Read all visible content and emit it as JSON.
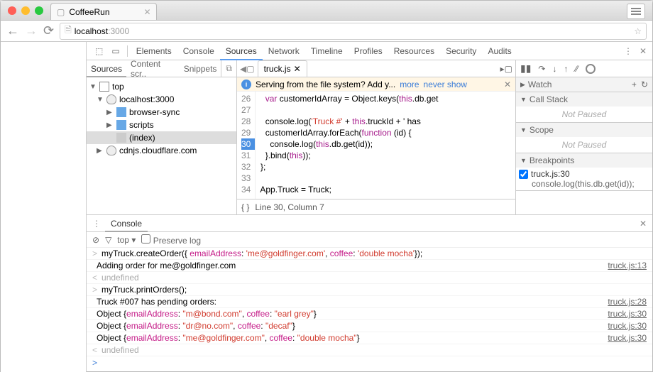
{
  "browser": {
    "title": "CoffeeRun",
    "url_host": "localhost",
    "url_path": ":3000"
  },
  "devtabs": [
    "Elements",
    "Console",
    "Sources",
    "Network",
    "Timeline",
    "Profiles",
    "Resources",
    "Security",
    "Audits"
  ],
  "devtabs_active": "Sources",
  "p1": {
    "tabs": [
      "Sources",
      "Content scr..",
      "Snippets"
    ],
    "tree": {
      "top": "top",
      "host": "localhost:3000",
      "browser_sync": "browser-sync",
      "scripts": "scripts",
      "index": "(index)",
      "cdn": "cdnjs.cloudflare.com"
    }
  },
  "file": {
    "name": "truck.js"
  },
  "info": {
    "msg": "Serving from the file system? Add y...",
    "more": "more",
    "never": "never show"
  },
  "code": {
    "start": 26,
    "highlight": 30,
    "lines": [
      "    var customerIdArray = Object.keys(this.db.get",
      "",
      "    console.log('Truck #' + this.truckId + ' has",
      "    customerIdArray.forEach(function (id) {",
      "      console.log(this.db.get(id));",
      "    }.bind(this));",
      "  };",
      "",
      "  App.Truck = Truck;"
    ]
  },
  "status": {
    "pos": "Line 30, Column 7"
  },
  "sections": {
    "watch": "Watch",
    "callstack": "Call Stack",
    "np": "Not Paused",
    "scope": "Scope",
    "breakpoints": "Breakpoints"
  },
  "bp": {
    "label": "truck.js:30",
    "code": "console.log(this.db.get(id));"
  },
  "drawer": {
    "tab": "Console"
  },
  "conbar": {
    "ctx": "top",
    "preserve": "Preserve log"
  },
  "console": [
    {
      "pfx": ">",
      "text": "myTruck.createOrder({ emailAddress: 'me@goldfinger.com', coffee: 'double mocha'});",
      "link": ""
    },
    {
      "pfx": "",
      "text": "Adding order for me@goldfinger.com",
      "link": "truck.js:13"
    },
    {
      "pfx": "<",
      "text": "undefined",
      "link": "",
      "und": true
    },
    {
      "pfx": ">",
      "text": "myTruck.printOrders();",
      "link": ""
    },
    {
      "pfx": "",
      "text": "Truck #007 has pending orders:",
      "link": "truck.js:28"
    },
    {
      "pfx": "",
      "obj": true,
      "email": "m@bond.com",
      "coffee": "earl grey",
      "link": "truck.js:30"
    },
    {
      "pfx": "",
      "obj": true,
      "email": "dr@no.com",
      "coffee": "decaf",
      "link": "truck.js:30"
    },
    {
      "pfx": "",
      "obj": true,
      "email": "me@goldfinger.com",
      "coffee": "double mocha",
      "link": "truck.js:30"
    },
    {
      "pfx": "<",
      "text": "undefined",
      "link": "",
      "und": true
    }
  ]
}
